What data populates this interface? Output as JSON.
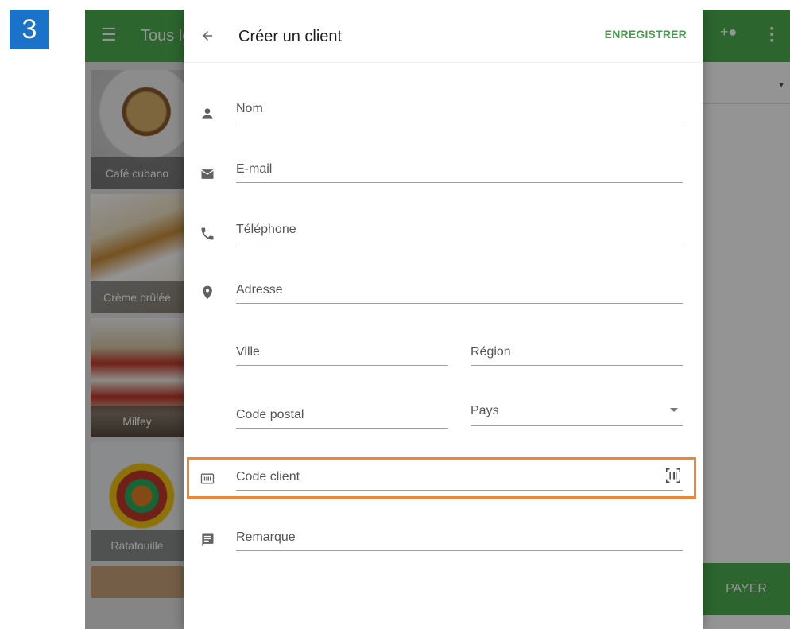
{
  "step": {
    "number": "3"
  },
  "background": {
    "title": "Tous les",
    "tiles": [
      "Café cubano",
      "Crème brûlée",
      "Milfey",
      "Ratatouille"
    ],
    "pay_label": "PAYER"
  },
  "form": {
    "title": "Créer un client",
    "save_label": "ENREGISTRER",
    "fields": {
      "name": "Nom",
      "email": "E-mail",
      "phone": "Téléphone",
      "address": "Adresse",
      "city": "Ville",
      "region": "Région",
      "postal_code": "Code postal",
      "country": "Pays",
      "customer_code": "Code client",
      "note": "Remarque"
    }
  },
  "colors": {
    "accent_green": "#4caf50",
    "save_green": "#43a047",
    "highlight_orange": "#f0862b",
    "step_blue": "#1a73c8"
  },
  "icons": [
    "menu-icon",
    "add-person-icon",
    "more-vert-icon",
    "arrow-back-icon",
    "person-icon",
    "email-icon",
    "phone-icon",
    "location-icon",
    "card-icon",
    "barcode-scan-icon",
    "comment-icon"
  ]
}
